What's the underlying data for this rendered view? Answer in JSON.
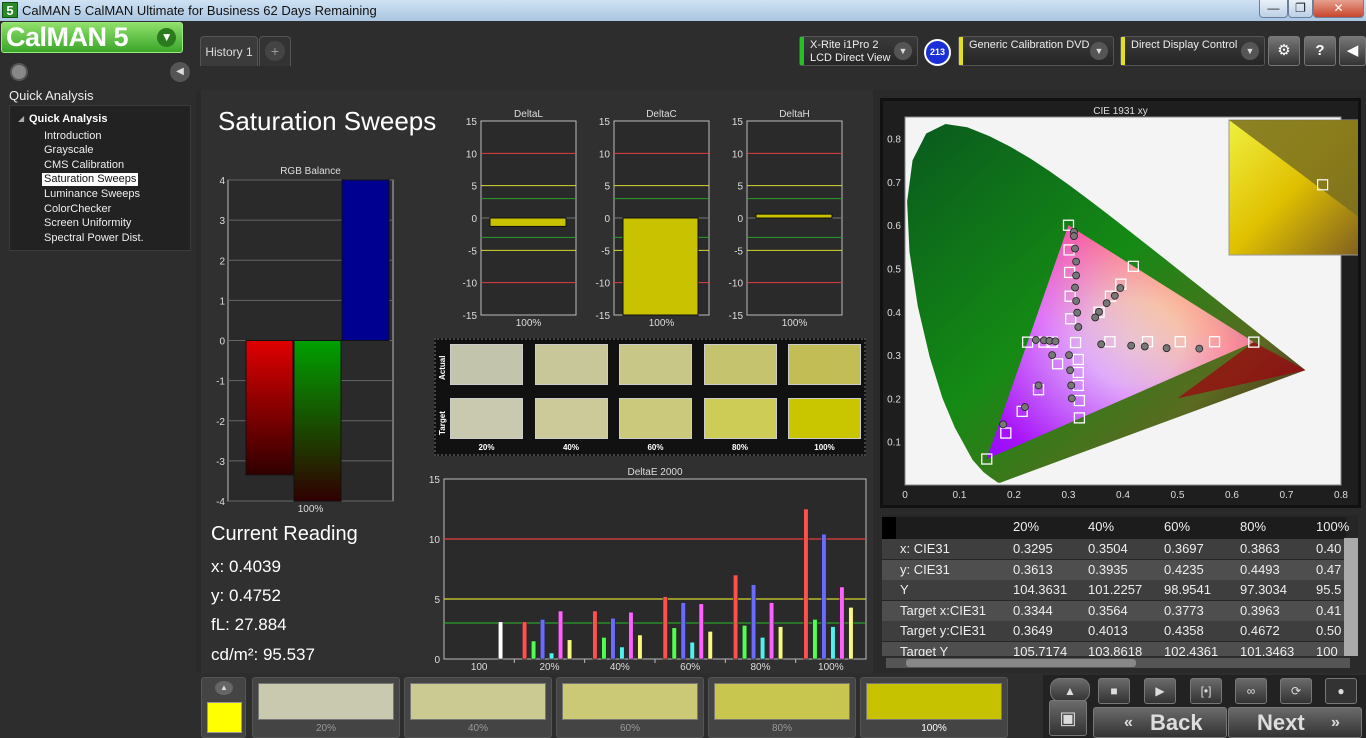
{
  "window": {
    "title": "CalMAN 5 CalMAN Ultimate for Business 62 Days Remaining",
    "app_icon": "5"
  },
  "logo": {
    "text": "CalMAN 5"
  },
  "tabs": [
    {
      "label": "History 1"
    },
    {
      "label": "+"
    }
  ],
  "devices": {
    "meter": {
      "line1": "X-Rite i1Pro 2",
      "line2": "LCD Direct View",
      "badge": "213",
      "color": "#25c025"
    },
    "source": {
      "label": "Generic Calibration DVD",
      "color": "#e0e020"
    },
    "display": {
      "label": "Direct Display Control",
      "color": "#e0e020"
    }
  },
  "sidebar": {
    "title": "Quick Analysis",
    "root": "Quick Analysis",
    "items": [
      {
        "label": "Introduction",
        "selected": false
      },
      {
        "label": "Grayscale",
        "selected": false
      },
      {
        "label": "CMS Calibration",
        "selected": false
      },
      {
        "label": "Saturation Sweeps",
        "selected": true
      },
      {
        "label": "Luminance Sweeps",
        "selected": false
      },
      {
        "label": "ColorChecker",
        "selected": false
      },
      {
        "label": "Screen Uniformity",
        "selected": false
      },
      {
        "label": "Spectral Power Dist.",
        "selected": false
      }
    ]
  },
  "page": {
    "title": "Saturation Sweeps"
  },
  "current_reading": {
    "header": "Current Reading",
    "x": "x: 0.4039",
    "y": "y: 0.4752",
    "fl": "fL: 27.884",
    "cdm2": "cd/m²: 95.537"
  },
  "chart_data": [
    {
      "type": "bar",
      "title": "RGB Balance",
      "categories": [
        "100%"
      ],
      "series": [
        {
          "values": [
            -3.35
          ],
          "color": "#e00000"
        },
        {
          "values": [
            -4.0
          ],
          "color": "#00a000"
        },
        {
          "values": [
            4.0
          ],
          "color": "#000090"
        }
      ],
      "ylim": [
        -4,
        4
      ],
      "ticks": [
        4,
        3,
        2,
        1,
        0,
        -1,
        -2,
        -3,
        -4
      ]
    },
    {
      "type": "bar",
      "title": "DeltaL",
      "categories": [
        "100%"
      ],
      "values": [
        -1.3
      ],
      "ylim": [
        -15,
        15
      ],
      "ticks": [
        15,
        10,
        5,
        0,
        -5,
        -10,
        -15
      ]
    },
    {
      "type": "bar",
      "title": "DeltaC",
      "categories": [
        "100%"
      ],
      "values": [
        -15
      ],
      "ylim": [
        -15,
        15
      ],
      "ticks": [
        15,
        10,
        5,
        0,
        -5,
        -10,
        -15
      ]
    },
    {
      "type": "bar",
      "title": "DeltaH",
      "categories": [
        "100%"
      ],
      "values": [
        0.6
      ],
      "ylim": [
        -15,
        15
      ],
      "ticks": [
        15,
        10,
        5,
        0,
        -5,
        -10,
        -15
      ]
    },
    {
      "type": "bar",
      "title": "DeltaE 2000",
      "categories": [
        "100",
        "20%",
        "40%",
        "60%",
        "80%",
        "100%"
      ],
      "ylim": [
        0,
        15
      ],
      "ticks": [
        15,
        10,
        5,
        0
      ],
      "reference_lines": [
        10,
        5,
        3
      ],
      "series": [
        {
          "color": "#ff5050",
          "values": [
            0,
            3.1,
            4.0,
            5.2,
            7.0,
            12.5
          ]
        },
        {
          "color": "#50ff50",
          "values": [
            0,
            1.5,
            1.8,
            2.6,
            2.8,
            3.3
          ]
        },
        {
          "color": "#6a6aff",
          "values": [
            0,
            3.3,
            3.4,
            4.7,
            6.2,
            10.4
          ]
        },
        {
          "color": "#50f0f0",
          "values": [
            0,
            0.5,
            1.0,
            1.4,
            1.8,
            2.7
          ]
        },
        {
          "color": "#ff60ff",
          "values": [
            0,
            4.0,
            3.9,
            4.6,
            4.7,
            6.0
          ]
        },
        {
          "color": "#f8f880",
          "values": [
            0,
            1.6,
            2.0,
            2.3,
            2.7,
            4.3
          ]
        },
        {
          "color": "#ffffff",
          "values": [
            3.1,
            0,
            0,
            0,
            0,
            0
          ]
        }
      ]
    },
    {
      "type": "scatter",
      "title": "CIE 1931 xy",
      "xlim": [
        0,
        0.8
      ],
      "ylim": [
        0,
        0.85
      ],
      "xticks": [
        0,
        0.1,
        0.2,
        0.3,
        0.4,
        0.5,
        0.6,
        0.7,
        0.8
      ],
      "yticks": [
        0.1,
        0.2,
        0.3,
        0.4,
        0.5,
        0.6,
        0.7,
        0.8
      ],
      "gamut": [
        [
          0.64,
          0.33
        ],
        [
          0.3,
          0.6
        ],
        [
          0.15,
          0.06
        ]
      ],
      "targets": [
        [
          0.64,
          0.33
        ],
        [
          0.568,
          0.331
        ],
        [
          0.505,
          0.331
        ],
        [
          0.445,
          0.331
        ],
        [
          0.376,
          0.331
        ],
        [
          0.3,
          0.6
        ],
        [
          0.301,
          0.543
        ],
        [
          0.302,
          0.491
        ],
        [
          0.303,
          0.436
        ],
        [
          0.304,
          0.384
        ],
        [
          0.15,
          0.06
        ],
        [
          0.185,
          0.12
        ],
        [
          0.215,
          0.17
        ],
        [
          0.245,
          0.22
        ],
        [
          0.28,
          0.28
        ],
        [
          0.225,
          0.33
        ],
        [
          0.255,
          0.33
        ],
        [
          0.27,
          0.33
        ],
        [
          0.313,
          0.329
        ],
        [
          0.419,
          0.505
        ],
        [
          0.396,
          0.464
        ],
        [
          0.377,
          0.436
        ],
        [
          0.356,
          0.399
        ],
        [
          0.32,
          0.155
        ],
        [
          0.32,
          0.195
        ],
        [
          0.318,
          0.23
        ],
        [
          0.318,
          0.26
        ],
        [
          0.318,
          0.29
        ]
      ],
      "measured": [
        [
          0.54,
          0.315
        ],
        [
          0.48,
          0.316
        ],
        [
          0.44,
          0.32
        ],
        [
          0.415,
          0.322
        ],
        [
          0.36,
          0.325
        ],
        [
          0.31,
          0.585
        ],
        [
          0.31,
          0.575
        ],
        [
          0.312,
          0.546
        ],
        [
          0.314,
          0.516
        ],
        [
          0.314,
          0.484
        ],
        [
          0.312,
          0.456
        ],
        [
          0.314,
          0.425
        ],
        [
          0.316,
          0.398
        ],
        [
          0.318,
          0.365
        ],
        [
          0.395,
          0.455
        ],
        [
          0.385,
          0.437
        ],
        [
          0.37,
          0.42
        ],
        [
          0.356,
          0.4
        ],
        [
          0.349,
          0.387
        ],
        [
          0.22,
          0.18
        ],
        [
          0.245,
          0.23
        ],
        [
          0.27,
          0.3
        ],
        [
          0.18,
          0.14
        ],
        [
          0.24,
          0.335
        ],
        [
          0.255,
          0.334
        ],
        [
          0.265,
          0.333
        ],
        [
          0.276,
          0.332
        ],
        [
          0.301,
          0.3
        ],
        [
          0.303,
          0.265
        ],
        [
          0.305,
          0.23
        ],
        [
          0.306,
          0.2
        ]
      ],
      "inset": {
        "marker": [
          0.72,
          0.52
        ]
      }
    }
  ],
  "swatches": {
    "rows": [
      "Actual",
      "Target"
    ],
    "percents": [
      "20%",
      "40%",
      "60%",
      "80%",
      "100%"
    ],
    "actual_colors": [
      "#c3c4ac",
      "#c7c79a",
      "#c8c787",
      "#c6c36f",
      "#c3bd55"
    ],
    "target_colors": [
      "#c9c9af",
      "#cbca98",
      "#cbc97b",
      "#cdcc56",
      "#c9c600"
    ]
  },
  "table": {
    "headers": [
      "20%",
      "40%",
      "60%",
      "80%",
      "100%"
    ],
    "rows": [
      {
        "label": "x: CIE31",
        "values": [
          "0.3295",
          "0.3504",
          "0.3697",
          "0.3863",
          "0.40"
        ]
      },
      {
        "label": "y: CIE31",
        "values": [
          "0.3613",
          "0.3935",
          "0.4235",
          "0.4493",
          "0.47"
        ]
      },
      {
        "label": "Y",
        "values": [
          "104.3631",
          "101.2257",
          "98.9541",
          "97.3034",
          "95.5"
        ]
      },
      {
        "label": "Target x:CIE31",
        "values": [
          "0.3344",
          "0.3564",
          "0.3773",
          "0.3963",
          "0.41"
        ]
      },
      {
        "label": "Target y:CIE31",
        "values": [
          "0.3649",
          "0.4013",
          "0.4358",
          "0.4672",
          "0.50"
        ]
      },
      {
        "label": "Target Y",
        "values": [
          "105.7174",
          "103.8618",
          "102.4361",
          "101.3463",
          "100"
        ]
      }
    ]
  },
  "bottom_swatches": [
    {
      "label": "20%",
      "color": "#c9c9b0"
    },
    {
      "label": "40%",
      "color": "#cbca93"
    },
    {
      "label": "60%",
      "color": "#cbc975"
    },
    {
      "label": "80%",
      "color": "#c9c650"
    },
    {
      "label": "100%",
      "color": "#c6c200"
    }
  ],
  "current_swatch_color": "#ffff00",
  "nav": {
    "back": "Back",
    "next": "Next"
  }
}
